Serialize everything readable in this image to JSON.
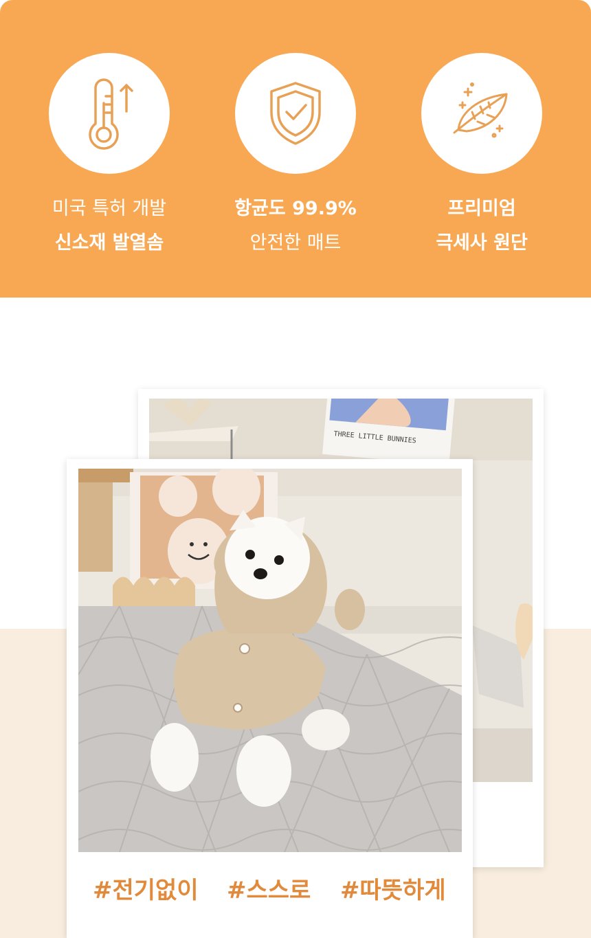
{
  "features": [
    {
      "icon": "thermometer-up-icon",
      "line1": "미국 특허 개발",
      "line2": "신소재 발열솜"
    },
    {
      "icon": "shield-check-icon",
      "line1": "항균도 99.9%",
      "line2": "안전한 매트"
    },
    {
      "icon": "feather-sparkle-icon",
      "line1": "프리미엄",
      "line2": "극세사 원단"
    }
  ],
  "back_photo": {
    "poster_text": "THREE LITTLE BUNNIES"
  },
  "hashtags": [
    "#전기없이",
    "#스스로",
    "#따뜻하게"
  ],
  "colors": {
    "banner": "#f8a853",
    "icon_stroke": "#e8a055",
    "hashtag": "#e28a3b",
    "cream_band": "#f8eddf"
  }
}
